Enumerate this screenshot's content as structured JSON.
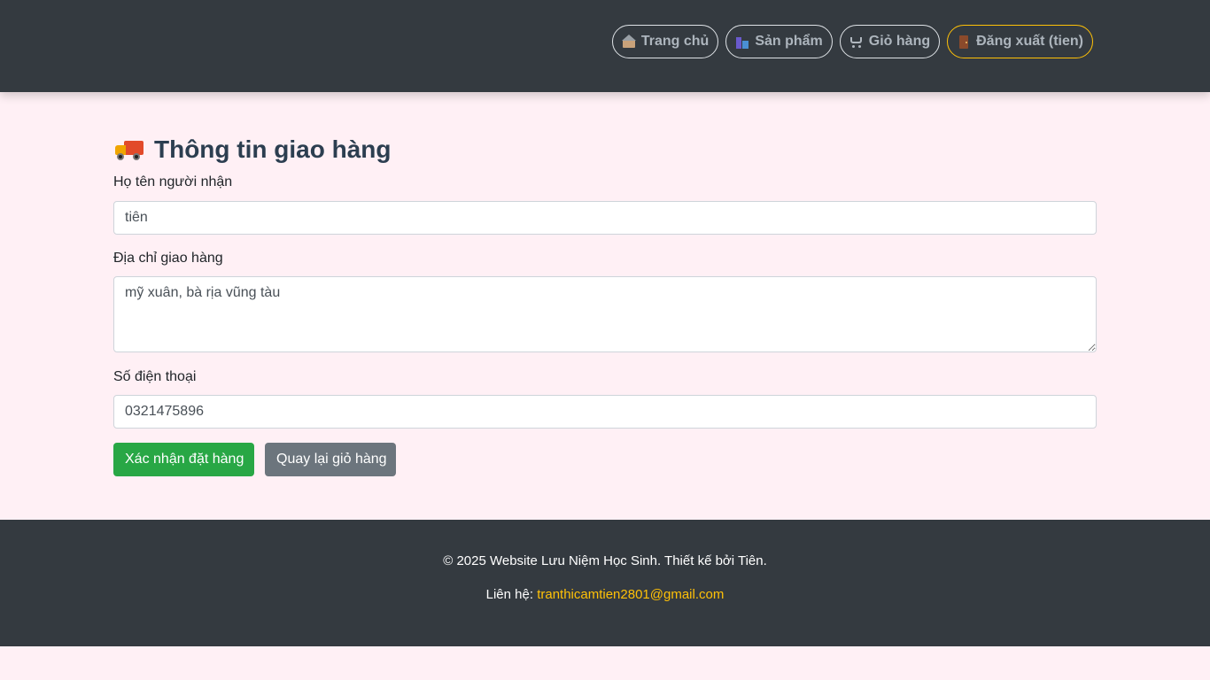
{
  "nav": {
    "items": [
      {
        "label": "Trang chủ",
        "icon": "house-icon"
      },
      {
        "label": "Sản phẩm",
        "icon": "products-icon"
      },
      {
        "label": "Giỏ hàng",
        "icon": "cart-icon"
      },
      {
        "label": "Đăng xuất (tien)",
        "icon": "door-icon"
      }
    ]
  },
  "page": {
    "title": "Thông tin giao hàng",
    "title_icon": "truck-icon"
  },
  "form": {
    "name_label": "Họ tên người nhận",
    "name_value": "tiên",
    "address_label": "Địa chỉ giao hàng",
    "address_value": "mỹ xuân, bà rịa vũng tàu",
    "phone_label": "Số điện thoại",
    "phone_value": "0321475896",
    "confirm_label": "Xác nhận đặt hàng",
    "back_label": "Quay lại giỏ hàng"
  },
  "footer": {
    "copyright": "© 2025 Website Lưu Niệm Học Sinh. Thiết kế bởi Tiên.",
    "contact_label": "Liên hệ:",
    "email": "tranthicamtien2801@gmail.com"
  },
  "colors": {
    "navbar_bg": "#343a40",
    "page_bg": "#fff0f5",
    "confirm_button": "#28a745",
    "back_button": "#6c757d",
    "logout_border": "#ffc107",
    "email_link": "#ffc107"
  }
}
